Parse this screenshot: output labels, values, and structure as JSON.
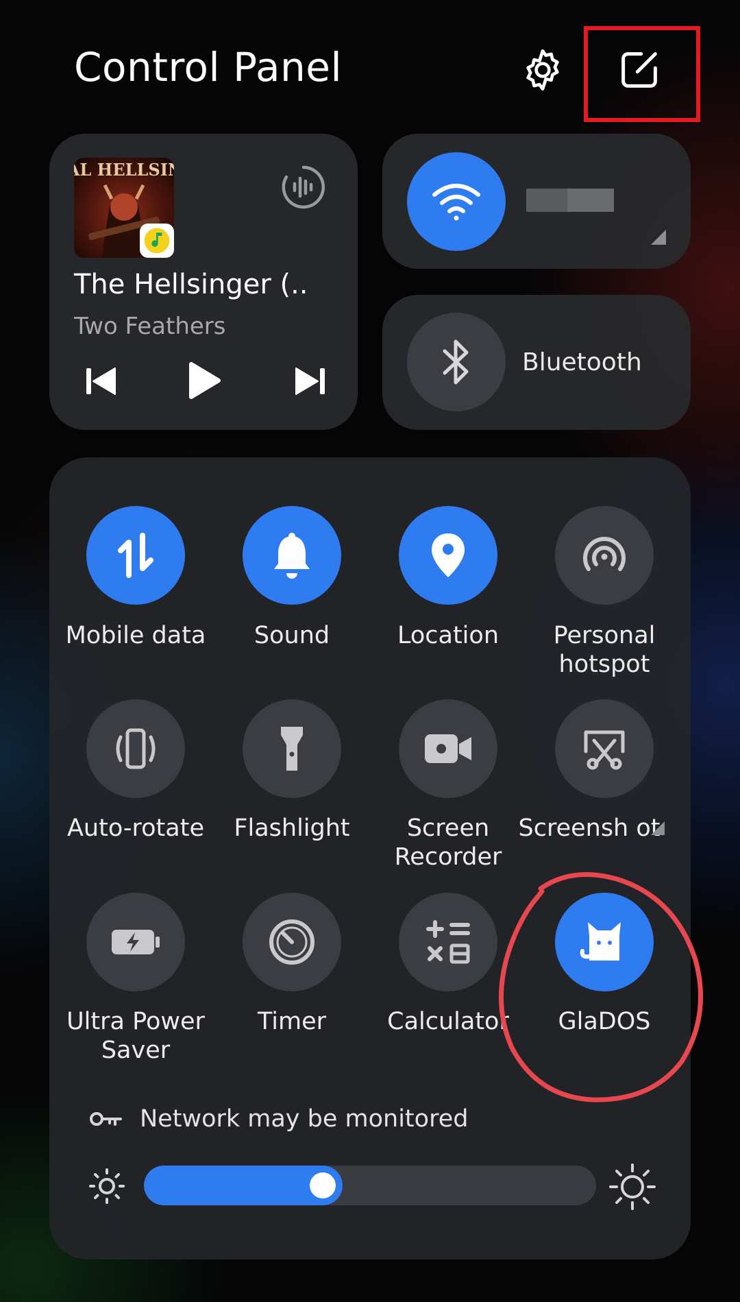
{
  "header": {
    "title": "Control Panel",
    "settings_icon": "gear-icon",
    "edit_icon": "edit-icon",
    "highlight_color": "#e11d22"
  },
  "media": {
    "album_text": "METAL HELLSINGER",
    "title": "The Hellsinger (..",
    "artist": "Two Feathers",
    "app_badge_icon": "music-note-icon",
    "controls": [
      "previous",
      "play",
      "next"
    ]
  },
  "wifi": {
    "icon": "wifi-icon",
    "active": true
  },
  "bluetooth": {
    "label": "Bluetooth",
    "active": false
  },
  "tiles": [
    {
      "id": "mobile-data",
      "label": "Mobile data",
      "icon": "data-transfer-icon",
      "active": true
    },
    {
      "id": "sound",
      "label": "Sound",
      "icon": "bell-icon",
      "active": true
    },
    {
      "id": "location",
      "label": "Location",
      "icon": "location-pin-icon",
      "active": true
    },
    {
      "id": "personal-hotspot",
      "label": "Personal hotspot",
      "icon": "hotspot-icon",
      "active": false
    },
    {
      "id": "auto-rotate",
      "label": "Auto-rotate",
      "icon": "rotate-icon",
      "active": false
    },
    {
      "id": "flashlight",
      "label": "Flashlight",
      "icon": "flashlight-icon",
      "active": false
    },
    {
      "id": "screen-recorder",
      "label": "Screen Recorder",
      "icon": "video-camera-icon",
      "active": false
    },
    {
      "id": "screenshot",
      "label": "Screensh ot",
      "icon": "scissors-icon",
      "active": false
    },
    {
      "id": "ultra-power-saver",
      "label": "Ultra Power Saver",
      "icon": "battery-bolt-icon",
      "active": false
    },
    {
      "id": "timer",
      "label": "Timer",
      "icon": "timer-icon",
      "active": false
    },
    {
      "id": "calculator",
      "label": "Calculator",
      "icon": "calculator-icon",
      "active": false
    },
    {
      "id": "glados",
      "label": "GlaDOS",
      "icon": "cat-icon",
      "active": true
    }
  ],
  "network_notice": "Network may be monitored",
  "brightness": {
    "level": 0.44
  },
  "colors": {
    "accent": "#2f7bf0",
    "annotation": "#e8474f"
  }
}
